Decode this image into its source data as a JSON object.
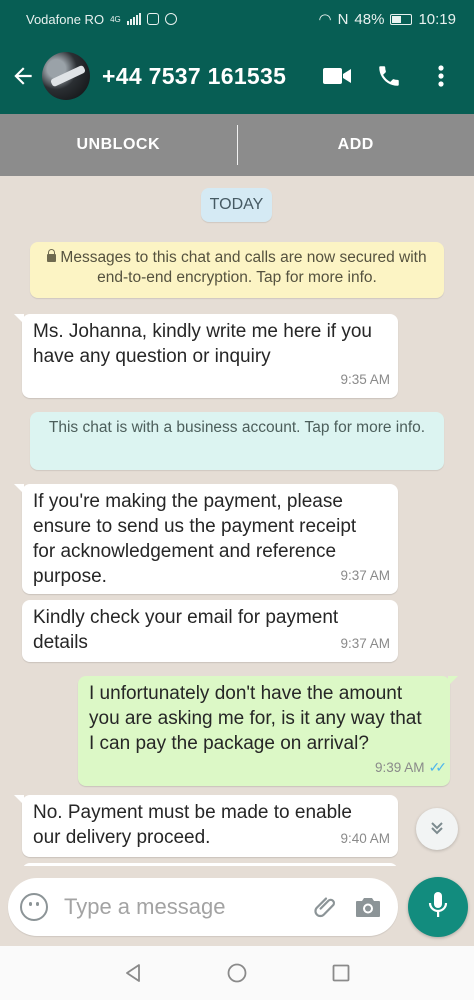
{
  "status_bar": {
    "carrier": "Vodafone RO",
    "network": "4G",
    "battery": "48%",
    "time": "10:19"
  },
  "header": {
    "contact_name": "+44 7537 161535"
  },
  "block_bar": {
    "unblock_label": "UNBLOCK",
    "add_label": "ADD"
  },
  "chat": {
    "date_label": "TODAY",
    "encryption_notice": "Messages to this chat and calls are now secured with end-to-end encryption. Tap for more info.",
    "business_notice": "This chat is with a business account. Tap for more info.",
    "messages": [
      {
        "direction": "in",
        "text": "Ms. Johanna, kindly write me here if you have any question or inquiry",
        "time": "9:35 AM"
      },
      {
        "direction": "in",
        "text": "If you're making the payment, please ensure to send us the payment receipt for acknowledgement and reference purpose.",
        "time": "9:37 AM"
      },
      {
        "direction": "in",
        "text": "Kindly check your email for payment details",
        "time": "9:37 AM"
      },
      {
        "direction": "out",
        "text": "I unfortunately don't have the amount you are asking me for, is it any way that I can pay the package on arrival?",
        "time": "9:39 AM",
        "status": "read"
      },
      {
        "direction": "in",
        "text": "No. Payment must be made to enable our delivery proceed.",
        "time": "9:40 AM"
      }
    ]
  },
  "composer": {
    "placeholder": "Type a message"
  },
  "colors": {
    "header": "#075e54",
    "accent": "#128c7e",
    "outgoing_bubble": "#dcf8c6",
    "incoming_bubble": "#ffffff",
    "read_ticks": "#4fb6ec"
  },
  "icons": [
    "back-arrow-icon",
    "video-call-icon",
    "phone-icon",
    "more-options-icon",
    "lock-icon",
    "double-check-icon",
    "chevron-down-icon",
    "emoji-icon",
    "paperclip-icon",
    "camera-icon",
    "microphone-icon",
    "nav-back-icon",
    "nav-home-icon",
    "nav-recents-icon"
  ]
}
